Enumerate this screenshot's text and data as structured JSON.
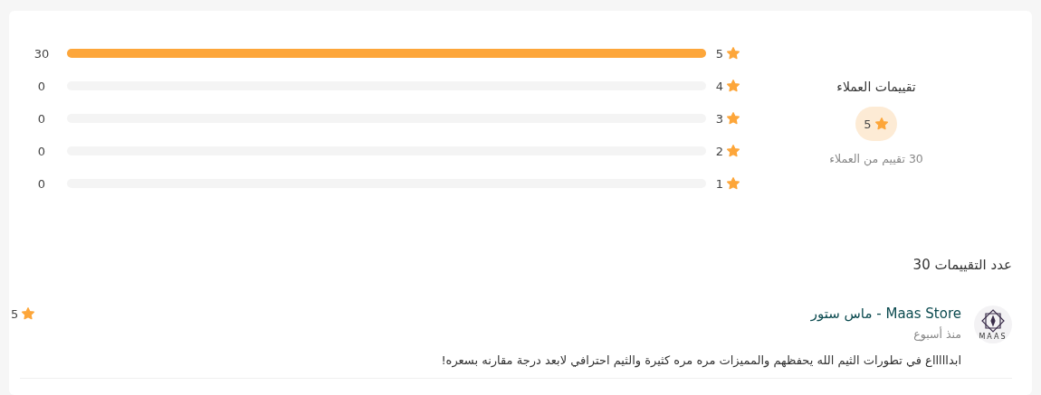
{
  "summary": {
    "title": "تقييمات العملاء",
    "average": "5",
    "subtitle": "30 تقييم من العملاء"
  },
  "distribution": [
    {
      "stars_label": "5",
      "count": "30",
      "level": 1
    },
    {
      "stars_label": "4",
      "count": "0",
      "level": 0
    },
    {
      "stars_label": "3",
      "count": "0",
      "level": 0
    },
    {
      "stars_label": "2",
      "count": "0",
      "level": 0
    },
    {
      "stars_label": "1",
      "count": "0",
      "level": 0
    }
  ],
  "reviews_heading": "عدد التقييمات 30",
  "reviews": [
    {
      "logo_text": "MAAS",
      "name": "Maas Store - ماس ستور",
      "time": "منذ أسبوع",
      "text": "ابداااااع في تطورات الثيم الله يحفظهم والمميزات مره مره كثيرة والثيم احترافي لابعد درجة مقارنه بسعره!",
      "rating": "5"
    }
  ]
}
